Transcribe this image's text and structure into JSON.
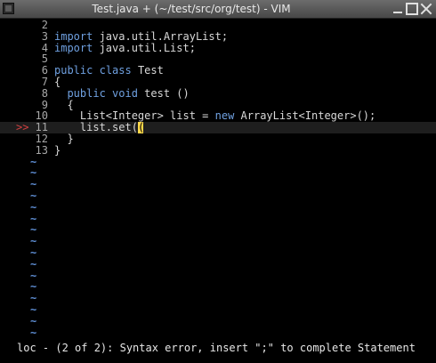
{
  "window": {
    "title": "Test.java + (~/test/src/org/test) - VIM",
    "buttons": [
      "minimize",
      "maximize",
      "close"
    ]
  },
  "colors": {
    "background": "#000000",
    "line_number": "#a8a8a8",
    "text": "#d8d8d8",
    "keyword": "#6fa0e0",
    "sign": "#d14040",
    "tilde": "#5f8fd6",
    "cursor": "#ffd84a"
  },
  "editor": {
    "lines": [
      {
        "num": "2",
        "sign": "",
        "segs": []
      },
      {
        "num": "3",
        "sign": "",
        "segs": [
          {
            "t": "import",
            "k": "kw"
          },
          {
            "t": " java.util.ArrayList;"
          }
        ]
      },
      {
        "num": "4",
        "sign": "",
        "segs": [
          {
            "t": "import",
            "k": "kw"
          },
          {
            "t": " java.util.List;"
          }
        ]
      },
      {
        "num": "5",
        "sign": "",
        "segs": []
      },
      {
        "num": "6",
        "sign": "",
        "segs": [
          {
            "t": "public",
            "k": "kw"
          },
          {
            "t": " "
          },
          {
            "t": "class",
            "k": "kw"
          },
          {
            "t": " Test"
          }
        ]
      },
      {
        "num": "7",
        "sign": "",
        "segs": [
          {
            "t": "{"
          }
        ]
      },
      {
        "num": "8",
        "sign": "",
        "segs": [
          {
            "t": "  "
          },
          {
            "t": "public",
            "k": "kw"
          },
          {
            "t": " "
          },
          {
            "t": "void",
            "k": "kw"
          },
          {
            "t": " test ()"
          }
        ]
      },
      {
        "num": "9",
        "sign": "",
        "segs": [
          {
            "t": "  {"
          }
        ]
      },
      {
        "num": "10",
        "sign": "",
        "segs": [
          {
            "t": "    List<Integer> list = "
          },
          {
            "t": "new",
            "k": "kw"
          },
          {
            "t": " ArrayList<Integer>();"
          }
        ]
      },
      {
        "num": "11",
        "sign": ">>",
        "cursorline": true,
        "segs": [
          {
            "t": "    list.set("
          },
          {
            "t": "(",
            "k": "cursor"
          }
        ]
      },
      {
        "num": "12",
        "sign": "",
        "segs": [
          {
            "t": "  }"
          }
        ]
      },
      {
        "num": "13",
        "sign": "",
        "segs": [
          {
            "t": "}"
          }
        ]
      }
    ],
    "empty_line_marker": "~",
    "empty_line_count": 16
  },
  "command_line": "loc - (2 of 2): Syntax error, insert \";\" to complete Statement"
}
